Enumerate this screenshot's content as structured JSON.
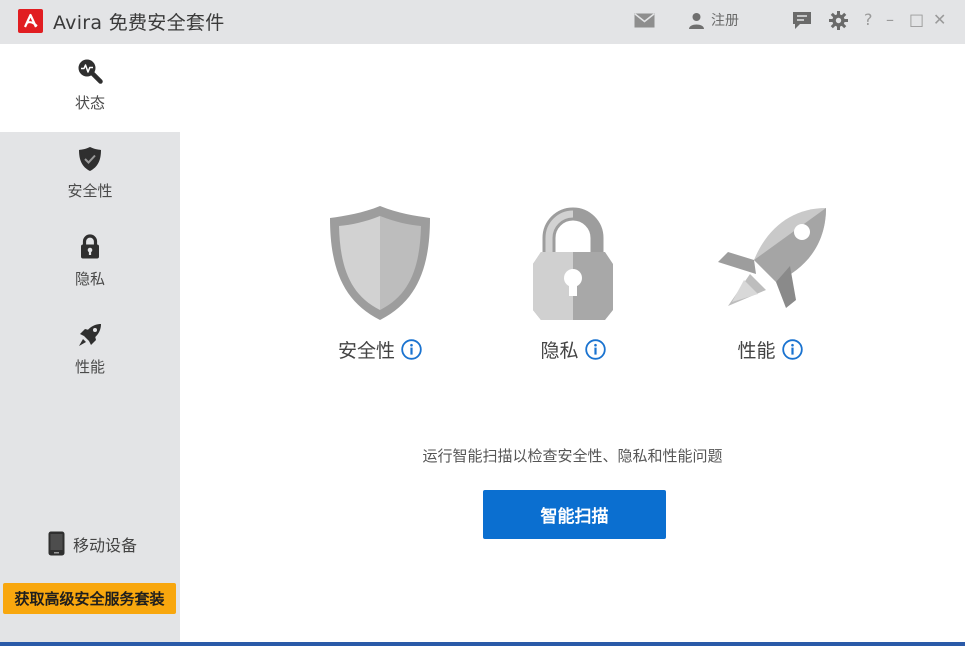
{
  "app": {
    "title": "Avira 免费安全套件",
    "logo_icon": "avira-logo-icon",
    "brand_color": "#e11d21"
  },
  "titlebar": {
    "mail_icon": "mail-icon",
    "register_label": "注册",
    "feedback_icon": "feedback-icon",
    "settings_icon": "gear-icon",
    "help_label": "?",
    "minimize_label": "–",
    "maximize_label": "□",
    "close_label": "✕"
  },
  "sidebar": {
    "items": [
      {
        "label": "状态",
        "icon": "status-search-icon",
        "active": true
      },
      {
        "label": "安全性",
        "icon": "shield-icon",
        "active": false
      },
      {
        "label": "隐私",
        "icon": "lock-icon",
        "active": false
      },
      {
        "label": "性能",
        "icon": "rocket-icon",
        "active": false
      }
    ],
    "mobile_label": "移动设备",
    "upgrade_label": "获取高级安全服务套装",
    "upgrade_color": "#f8a70e"
  },
  "main": {
    "features": [
      {
        "label": "安全性",
        "icon": "shield-icon"
      },
      {
        "label": "隐私",
        "icon": "lock-icon"
      },
      {
        "label": "性能",
        "icon": "rocket-icon"
      }
    ],
    "hint": "运行智能扫描以检查安全性、隐私和性能问题",
    "scan_button": "智能扫描",
    "accent_color": "#0b6fd0"
  }
}
